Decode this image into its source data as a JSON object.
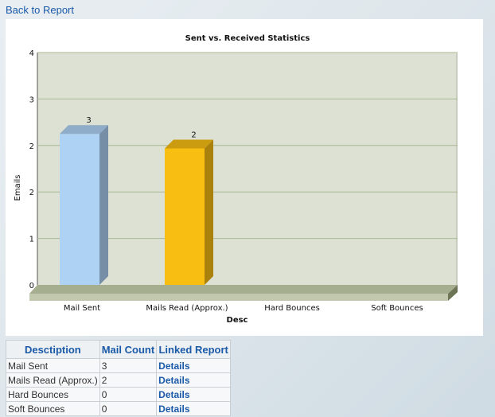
{
  "nav": {
    "back_label": "Back to Report"
  },
  "colors": {
    "plot_bg": "#dce1d3",
    "floor": "#a5ae8f",
    "link": "#1a5aa8",
    "series": [
      "#aed2f4",
      "#f8be12"
    ]
  },
  "chart_data": {
    "type": "bar",
    "title": "Sent vs. Received Statistics",
    "xlabel": "Desc",
    "ylabel": "Emails",
    "categories": [
      "Mail Sent",
      "Mails Read (Approx.)",
      "Hard Bounces",
      "Soft Bounces"
    ],
    "values": [
      2.6,
      2.35,
      0,
      0
    ],
    "data_labels": [
      "3",
      "2",
      "",
      ""
    ],
    "y_tick_labels": [
      "0",
      "1",
      "2",
      "2",
      "3",
      "4"
    ],
    "ylim": [
      0,
      4
    ],
    "grid": true,
    "legend": "none"
  },
  "table": {
    "headers": [
      "Desctiption",
      "Mail Count",
      "Linked Report"
    ],
    "rows": [
      {
        "desc": "Mail Sent",
        "count": "3",
        "link": "Details"
      },
      {
        "desc": "Mails Read (Approx.)",
        "count": "2",
        "link": "Details"
      },
      {
        "desc": "Hard Bounces",
        "count": "0",
        "link": "Details"
      },
      {
        "desc": "Soft Bounces",
        "count": "0",
        "link": "Details"
      }
    ]
  }
}
